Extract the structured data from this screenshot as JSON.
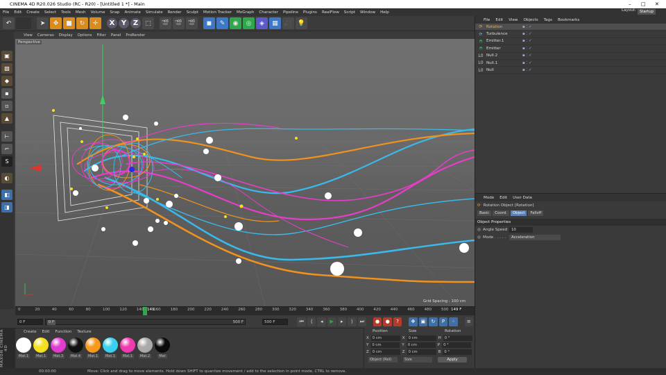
{
  "app": {
    "title": "CINEMA 4D R20.026 Studio (RC - R20) - [Untitled 1 *] - Main",
    "window_controls": [
      "–",
      "□",
      "✕"
    ]
  },
  "menu": [
    "File",
    "Edit",
    "Create",
    "Select",
    "Tools",
    "Mesh",
    "Volume",
    "Snap",
    "Animate",
    "Simulate",
    "Render",
    "Sculpt",
    "Motion Tracker",
    "MoGraph",
    "Character",
    "Pipeline",
    "Plugins",
    "RealFlow",
    "Script",
    "Window",
    "Help"
  ],
  "layout": {
    "label": "Layout:",
    "value": "Startup"
  },
  "viewport_menu": [
    "View",
    "Cameras",
    "Display",
    "Options",
    "Filter",
    "Panel",
    "ProRender"
  ],
  "viewport": {
    "label": "Perspective",
    "grid_spacing": "Grid Spacing : 100 cm"
  },
  "timeline": {
    "ticks": [
      "0",
      "20",
      "40",
      "60",
      "80",
      "100",
      "120",
      "140",
      "160",
      "180",
      "200",
      "220",
      "240",
      "260",
      "280",
      "300",
      "320",
      "340",
      "360",
      "380",
      "400",
      "420",
      "440",
      "460",
      "480",
      "500"
    ],
    "current_frame": "149",
    "current_label": "149 F"
  },
  "transport": {
    "start": "0 F",
    "start2": "0 F",
    "end": "500 F",
    "end2": "500 F"
  },
  "materials": {
    "menu": [
      "Create",
      "Edit",
      "Function",
      "Texture"
    ],
    "items": [
      {
        "name": "Mat.1",
        "color": "#ffffff"
      },
      {
        "name": "Mat.1",
        "color": "#f5e022"
      },
      {
        "name": "Mat.3",
        "color": "#e23bd0"
      },
      {
        "name": "Mat.4",
        "color": "#111111"
      },
      {
        "name": "Mat.1",
        "color": "#f59a1c"
      },
      {
        "name": "Mat.1",
        "color": "#3ad1f0"
      },
      {
        "name": "Mat.1",
        "color": "#f03bb0"
      },
      {
        "name": "Mat.2",
        "color": "#aaaaaa"
      },
      {
        "name": "Mat",
        "color": "#0a0a0a"
      }
    ]
  },
  "maxon": "MAXON CINEMA 4D",
  "coords": {
    "headers": [
      "Position",
      "Size",
      "Rotation"
    ],
    "rows": [
      {
        "axis": "X",
        "pos": "0 cm",
        "size_axis": "X",
        "size": "0 cm",
        "rot_axis": "H",
        "rot": "0 °"
      },
      {
        "axis": "Y",
        "pos": "0 cm",
        "size_axis": "Y",
        "size": "0 cm",
        "rot_axis": "P",
        "rot": "0 °"
      },
      {
        "axis": "Z",
        "pos": "0 cm",
        "size_axis": "Z",
        "size": "0 cm",
        "rot_axis": "B",
        "rot": "0 °"
      }
    ],
    "mode": "Object (Rel)",
    "size_mode": "Size",
    "apply": "Apply"
  },
  "status": {
    "time": "00:00:00",
    "message": "Move: Click and drag to move elements. Hold down SHIFT to quantize movement / add to the selection in point mode, CTRL to remove."
  },
  "objects": {
    "menu": [
      "File",
      "Edit",
      "View",
      "Objects",
      "Tags",
      "Bookmarks"
    ],
    "items": [
      {
        "name": "Rotation",
        "selected": true
      },
      {
        "name": "Turbulence",
        "selected": false
      },
      {
        "name": "Emitter.1",
        "selected": false
      },
      {
        "name": "Emitter",
        "selected": false
      },
      {
        "name": "Null.2",
        "selected": false
      },
      {
        "name": "Null.1",
        "selected": false
      },
      {
        "name": "Null",
        "selected": false
      }
    ]
  },
  "attributes": {
    "menu": [
      "Mode",
      "Edit",
      "User Data"
    ],
    "title": "Rotation Object [Rotation]",
    "tabs": [
      "Basic",
      "Coord.",
      "Object",
      "Falloff"
    ],
    "section": "Object Properties",
    "props": [
      {
        "label": "Angle Speed",
        "value": "10"
      },
      {
        "label": "Mode . . . . .",
        "value": "Acceleration"
      }
    ]
  }
}
